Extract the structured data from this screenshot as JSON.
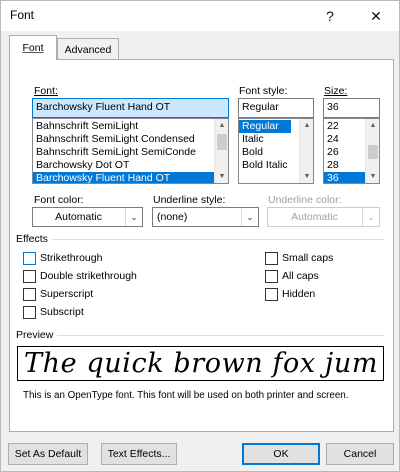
{
  "window": {
    "title": "Font",
    "help_glyph": "?",
    "close_glyph": "✕"
  },
  "tabs": [
    {
      "label": "Font",
      "mnemonic": "n",
      "active": true
    },
    {
      "label": "Advanced",
      "mnemonic": "v",
      "active": false
    }
  ],
  "font": {
    "label": "Font:",
    "value": "Barchowsky Fluent Hand OT",
    "list": [
      "Bahnschrift SemiLight",
      "Bahnschrift SemiLight Condensed",
      "Bahnschrift SemiLight SemiConde",
      "Barchowsky Dot OT",
      "Barchowsky Fluent Hand OT"
    ],
    "selected_index": 4
  },
  "font_style": {
    "label": "Font style:",
    "value": "Regular",
    "list": [
      "Regular",
      "Italic",
      "Bold",
      "Bold Italic"
    ],
    "selected_index": 0
  },
  "size": {
    "label": "Size:",
    "value": "36",
    "list": [
      "22",
      "24",
      "26",
      "28",
      "36"
    ],
    "selected_index": 4
  },
  "font_color": {
    "label": "Font color:",
    "value": "Automatic"
  },
  "underline_style": {
    "label": "Underline style:",
    "value": "(none)"
  },
  "underline_color": {
    "label": "Underline color:",
    "value": "Automatic",
    "disabled": true
  },
  "effects": {
    "title": "Effects",
    "left": [
      {
        "label": "Strikethrough",
        "checked": false
      },
      {
        "label": "Double strikethrough",
        "checked": false
      },
      {
        "label": "Superscript",
        "checked": false
      },
      {
        "label": "Subscript",
        "checked": false
      }
    ],
    "right": [
      {
        "label": "Small caps",
        "checked": false
      },
      {
        "label": "All caps",
        "checked": false
      },
      {
        "label": "Hidden",
        "checked": false
      }
    ]
  },
  "preview": {
    "title": "Preview",
    "sample": "The quick brown fox jum",
    "note": "This is an OpenType font. This font will be used on both printer and screen."
  },
  "buttons": {
    "set_default": "Set As Default",
    "text_effects": "Text Effects...",
    "ok": "OK",
    "cancel": "Cancel"
  },
  "colors": {
    "accent": "#0078d7",
    "selection_bg": "#cce8ff"
  }
}
